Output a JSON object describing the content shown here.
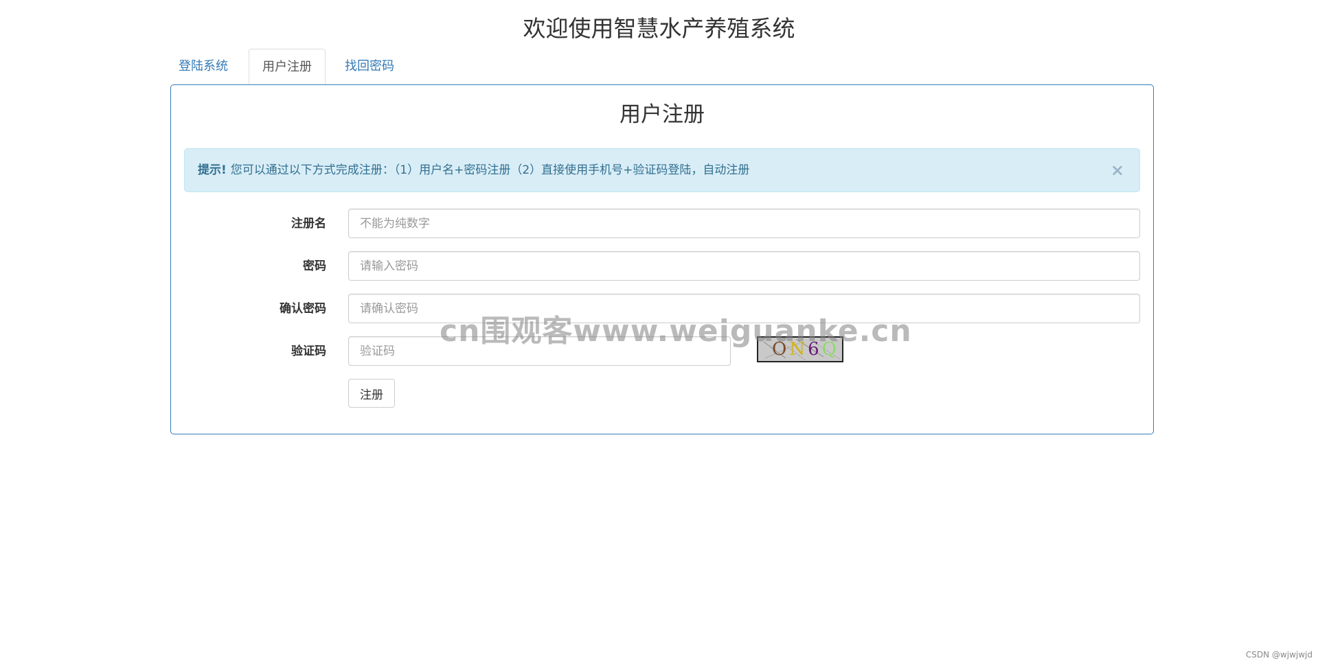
{
  "app": {
    "title": "欢迎使用智慧水产养殖系统"
  },
  "tabs": [
    {
      "label": "登陆系统",
      "active": false
    },
    {
      "label": "用户注册",
      "active": true
    },
    {
      "label": "找回密码",
      "active": false
    }
  ],
  "panel": {
    "title": "用户注册",
    "alert": {
      "strong": "提示!",
      "text": "您可以通过以下方式完成注册：（1）用户名+密码注册（2）直接使用手机号+验证码登陆，自动注册",
      "close": "×"
    }
  },
  "form": {
    "username": {
      "label": "注册名",
      "placeholder": "不能为纯数字",
      "value": ""
    },
    "password": {
      "label": "密码",
      "placeholder": "请输入密码",
      "value": ""
    },
    "confirm": {
      "label": "确认密码",
      "placeholder": "请确认密码",
      "value": ""
    },
    "captcha": {
      "label": "验证码",
      "placeholder": "验证码",
      "value": "",
      "code": [
        "O",
        "N",
        "6",
        "Q"
      ]
    },
    "submit_label": "注册"
  },
  "watermark": "cn围观客www.weiguanke.cn",
  "footer": {
    "credit": "CSDN @wjwjwjd"
  }
}
